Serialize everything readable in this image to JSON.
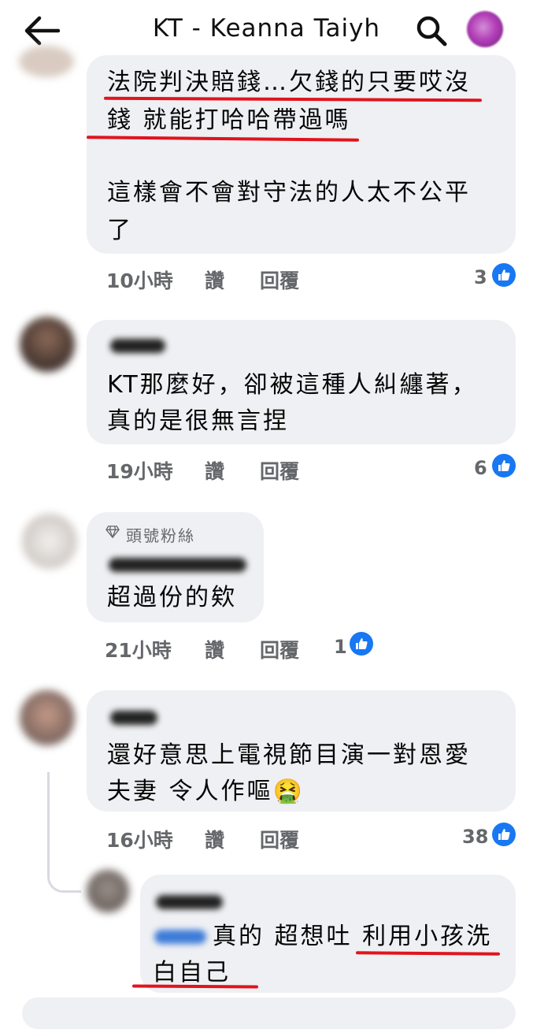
{
  "header": {
    "title": "KT - Keanna Taiyh"
  },
  "comments": [
    {
      "lines": [
        "法院判決賠錢…欠錢的只要哎沒",
        "錢 就能打哈哈帶過嗎",
        "",
        "這樣會不會對守法的人太不公平",
        "了"
      ],
      "time": "10小時",
      "like_label": "讚",
      "reply_label": "回覆",
      "likes": "3"
    },
    {
      "lines": [
        "KT那麼好，卻被這種人糾纏著，",
        "真的是很無言捏"
      ],
      "time": "19小時",
      "like_label": "讚",
      "reply_label": "回覆",
      "likes": "6"
    },
    {
      "badge": "頭號粉絲",
      "lines": [
        "超過份的欸"
      ],
      "time": "21小時",
      "like_label": "讚",
      "reply_label": "回覆",
      "likes": "1"
    },
    {
      "lines": [
        "還好意思上電視節目演一對恩愛",
        "夫妻 令人作嘔🤮"
      ],
      "time": "16小時",
      "like_label": "讚",
      "reply_label": "回覆",
      "likes": "38"
    },
    {
      "lines": [
        "真的 超想吐 利用小孩洗",
        "白自己"
      ]
    }
  ],
  "colors": {
    "bubble": "#eff0f3",
    "accent_like": "#1877f2",
    "underline": "#e0141e"
  }
}
